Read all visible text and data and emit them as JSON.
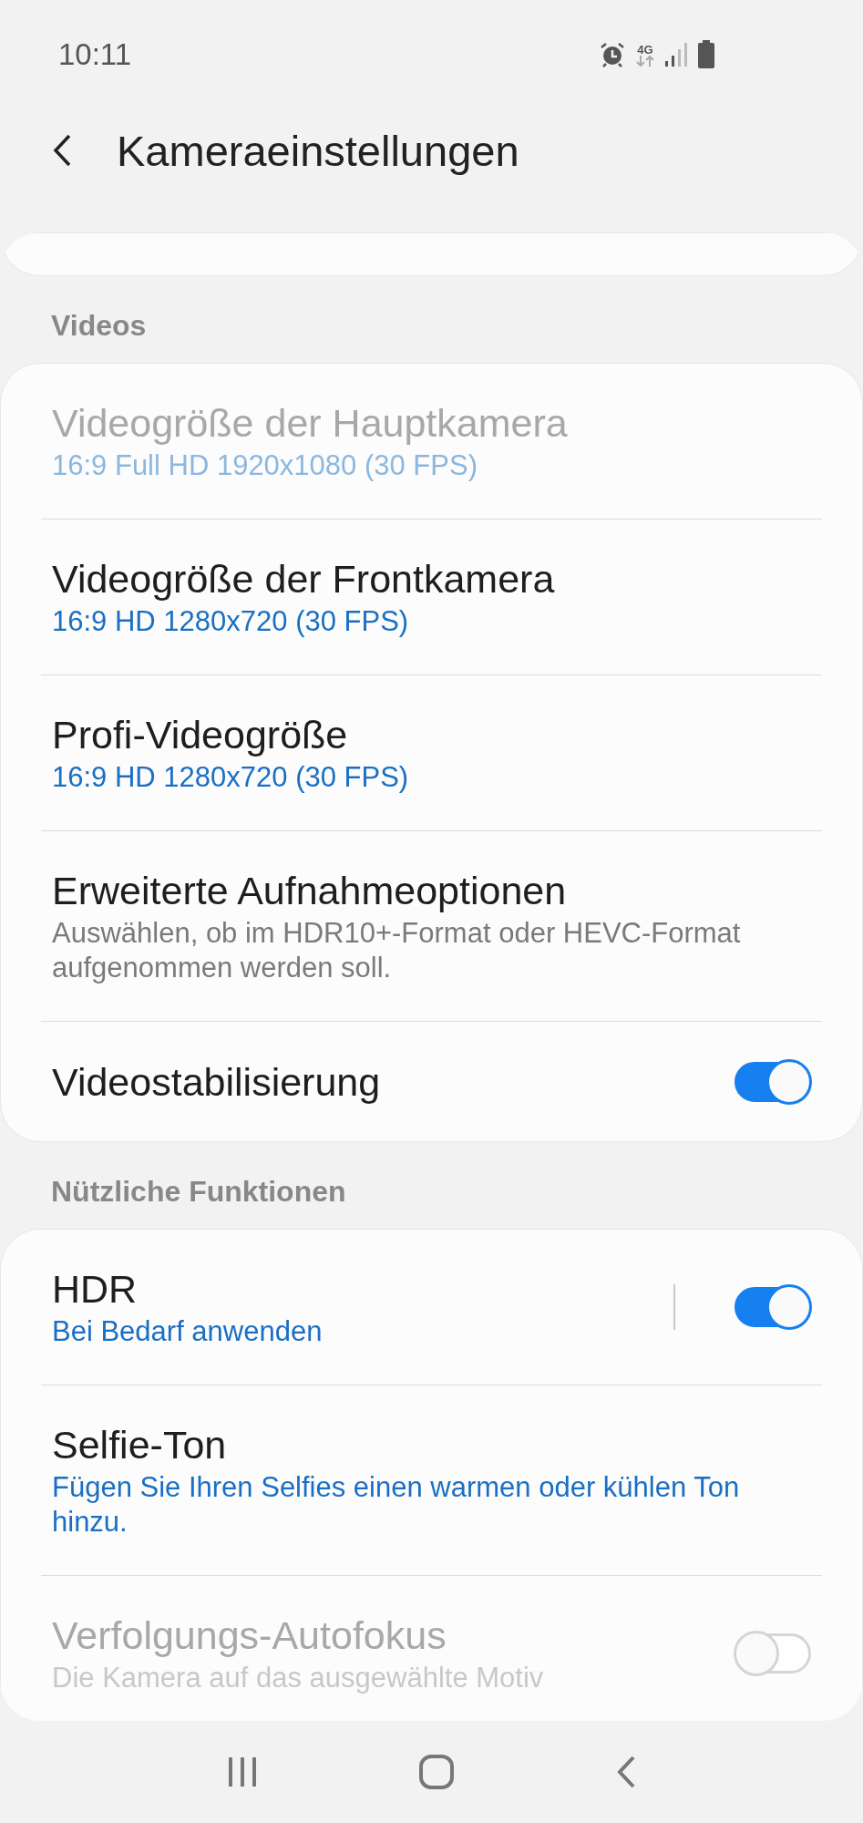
{
  "status_bar": {
    "time": "10:11",
    "network": "4G"
  },
  "header": {
    "title": "Kameraeinstellungen"
  },
  "sections": [
    {
      "title": "Videos",
      "items": [
        {
          "kind": "setting",
          "title": "Videogröße der Hauptkamera",
          "subtitle": "16:9 Full HD 1920x1080 (30 FPS)",
          "subtitle_highlighted": true,
          "disabled": true
        },
        {
          "kind": "setting",
          "title": "Videogröße der Frontkamera",
          "subtitle": "16:9 HD 1280x720 (30 FPS)",
          "subtitle_highlighted": true,
          "disabled": false
        },
        {
          "kind": "setting",
          "title": "Profi-Videogröße",
          "subtitle": "16:9 HD 1280x720 (30 FPS)",
          "subtitle_highlighted": true,
          "disabled": false
        },
        {
          "kind": "setting",
          "title": "Erweiterte Aufnahmeoptionen",
          "subtitle": "Auswählen, ob im HDR10+-Format oder HEVC-Format aufgenommen werden soll.",
          "subtitle_highlighted": false,
          "disabled": false
        },
        {
          "kind": "switch",
          "title": "Videostabilisierung",
          "on": true,
          "split": false,
          "disabled": false
        }
      ]
    },
    {
      "title": "Nützliche Funktionen",
      "items": [
        {
          "kind": "switch",
          "title": "HDR",
          "subtitle": "Bei Bedarf anwenden",
          "subtitle_highlighted": true,
          "on": true,
          "split": true,
          "disabled": false
        },
        {
          "kind": "setting",
          "title": "Selfie-Ton",
          "subtitle": "Fügen Sie Ihren Selfies einen warmen oder kühlen Ton hinzu.",
          "subtitle_highlighted": true,
          "disabled": false
        },
        {
          "kind": "switch",
          "title": "Verfolgungs-Autofokus",
          "subtitle": "Die Kamera auf das ausgewählte Motiv",
          "subtitle_highlighted": false,
          "on": false,
          "split": false,
          "disabled": true
        }
      ]
    }
  ]
}
